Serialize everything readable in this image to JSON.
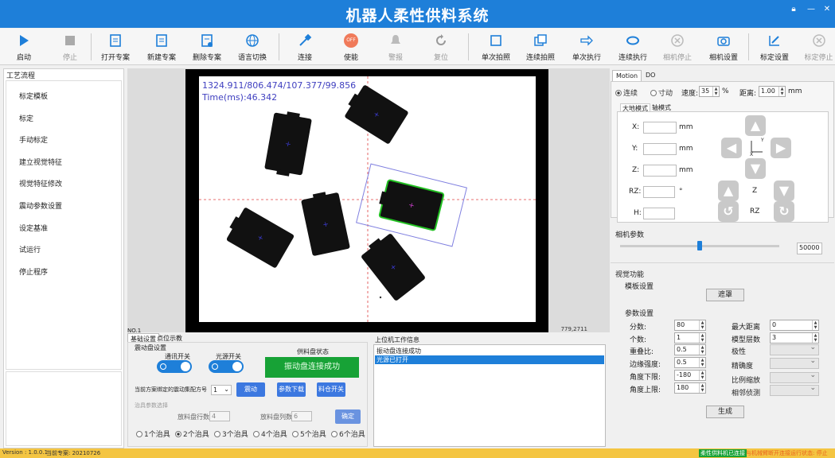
{
  "app": {
    "title": "机器人柔性供料系统"
  },
  "toolbar": {
    "start": "启动",
    "stop": "停止",
    "open_project": "打开专案",
    "new_project": "新建专案",
    "delete_project": "删除专案",
    "language": "语言切换",
    "connect": "连接",
    "enable": "使能",
    "enable_badge": "OFF",
    "alarm": "警报",
    "reset": "复位",
    "single_capture": "单次拍照",
    "continuous_capture": "连续拍照",
    "single_exec": "单次执行",
    "continuous_exec": "连续执行",
    "camera_stop": "相机停止",
    "camera_settings": "相机设置",
    "calib_settings": "标定设置",
    "calib_stop": "标定停止"
  },
  "left": {
    "title": "工艺流程",
    "items": [
      "标定模板",
      "标定",
      "手动标定",
      "建立视觉特征",
      "视觉特征修改",
      "震动参数设置",
      "设定基准",
      "试运行",
      "停止程序"
    ]
  },
  "viewer": {
    "hud_line1": "1324.911/806.474/107.377/99.856",
    "hud_line2": "Time(ms):46.342",
    "coord_readout": "779,2711",
    "no_label": "NO.1"
  },
  "bottom_tabs": [
    "基础设置",
    "点位示教"
  ],
  "vib": {
    "group_title": "震动盘设置",
    "comm_switch": "通讯开关",
    "light_switch": "光源开关",
    "feeder_status_label": "供料盘状态",
    "feeder_status_value": "振动盘连接成功",
    "plan_label": "当前方案绑定的震动集配方号",
    "plan_value": "1",
    "btn_vibrate": "震动",
    "btn_param_download": "参数下载",
    "btn_tray_switch": "料仓开关"
  },
  "fixture": {
    "group_title": "治具参数选择",
    "rows_label": "放料盘行数:",
    "rows_value": "4",
    "cols_label": "放料盘列数:",
    "cols_value": "6",
    "confirm": "确定",
    "options": [
      "1个治具",
      "2个治具",
      "3个治具",
      "4个治具",
      "5个治具",
      "6个治具"
    ],
    "selected": "2个治具"
  },
  "log": {
    "title": "上位机工作信息",
    "lines": [
      "振动盘连接成功",
      "光源已打开"
    ]
  },
  "right": {
    "tabs": [
      "Motion",
      "DO"
    ],
    "continuous": "连续",
    "jog": "寸动",
    "speed_label": "速度:",
    "speed_value": "35",
    "speed_unit": "%",
    "distance_label": "距离:",
    "distance_value": "1.00",
    "distance_unit": "mm",
    "mode_tabs": [
      "大地模式",
      "轴模式"
    ],
    "x_label": "X:",
    "y_label": "Y:",
    "z_label": "Z:",
    "rz_label": "RZ:",
    "h_label": "H:",
    "mm": "mm",
    "deg": "°",
    "z_pad_label": "Z",
    "rz_pad_label": "RZ",
    "axis_y": "Y",
    "axis_x": "X",
    "camera_params": "相机参数",
    "camera_slider_fraction": 0.5,
    "camera_value": "50000",
    "vision_title": "视觉功能",
    "template_title": "模板设置",
    "mask_btn": "遮罩",
    "params_title": "参数设置",
    "score_label": "分数:",
    "score_value": "80",
    "count_label": "个数:",
    "count_value": "1",
    "overlap_label": "重叠比:",
    "overlap_value": "0.5",
    "edge_label": "边缘强度:",
    "edge_value": "0.5",
    "angle_min_label": "角度下限:",
    "angle_min_value": "-180",
    "angle_max_label": "角度上限:",
    "angle_max_value": "180",
    "max_dist_label": "最大距离",
    "max_dist_value": "0",
    "layers_label": "模型层数",
    "layers_value": "3",
    "polarity_label": "极性",
    "precision_label": "精确度",
    "scale_label": "比例缩放",
    "neighbor_label": "相邻侦测",
    "generate_btn": "生成"
  },
  "status": {
    "version": "Version : 1.0.0.1",
    "project": "当前专案: 20210726",
    "robot_status": "柔性供料机已连接",
    "camera_status": "与机械臂断开连接",
    "run_status": "运行状态: 停止",
    "robot_status_color": "#17a236",
    "camera_status_color": "#e8641e"
  },
  "colors": {
    "accent": "#1e7fd9",
    "success": "#17a236"
  }
}
